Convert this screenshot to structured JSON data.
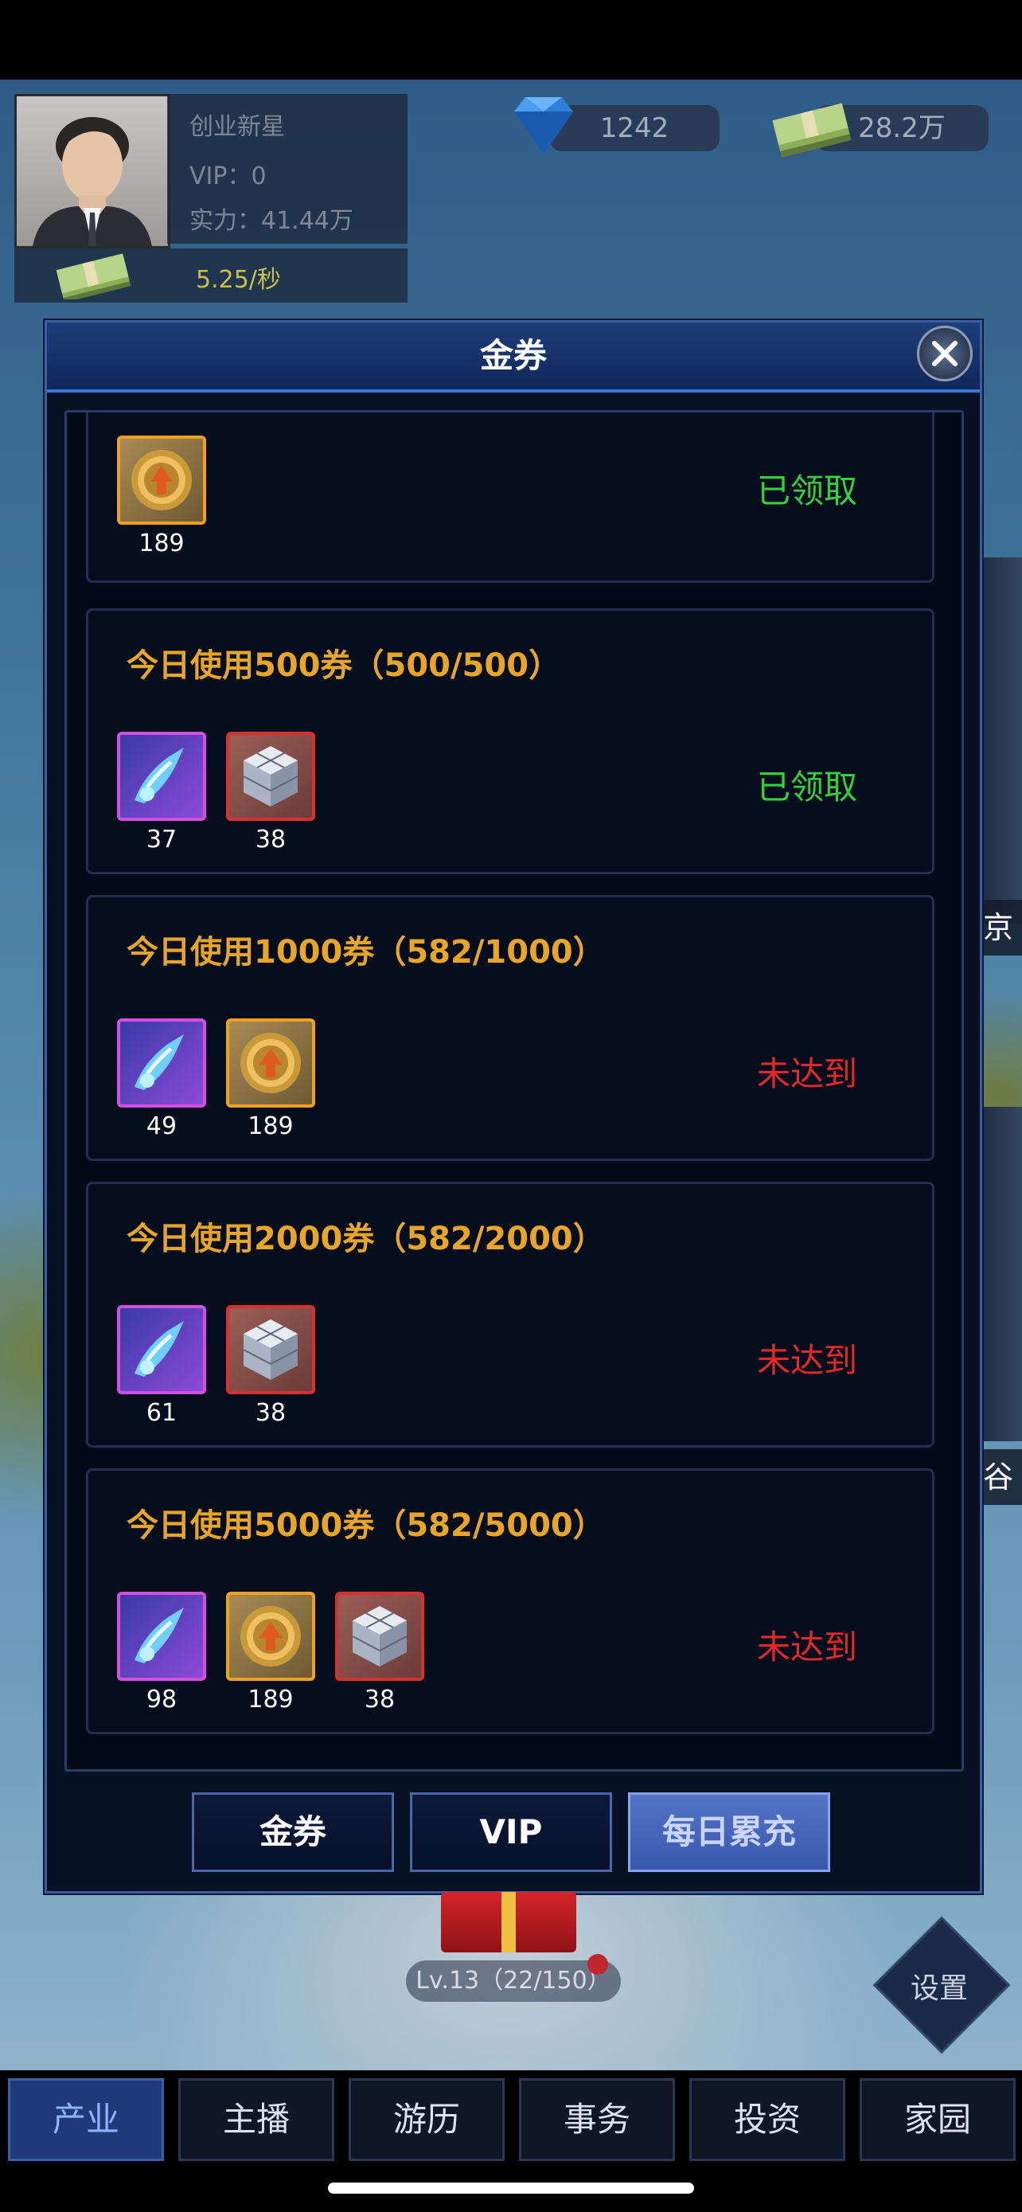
{
  "player": {
    "name": "创业新星",
    "vip": "VIP：0",
    "power": "实力：41.44万",
    "income_rate": "5.25/秒"
  },
  "resources": {
    "diamonds": "1242",
    "cash": "28.2万"
  },
  "map_labels": [
    "京",
    "谷"
  ],
  "dialog": {
    "title": "金券",
    "cards": [
      {
        "title": "",
        "items": [
          {
            "icon": "gold-gear-icon",
            "count": "189"
          }
        ],
        "status": "已领取",
        "status_color": "#32d23c"
      },
      {
        "title": "今日使用500券（500/500）",
        "items": [
          {
            "icon": "blue-crystal-icon",
            "count": "37"
          },
          {
            "icon": "ice-cube-icon",
            "count": "38"
          }
        ],
        "status": "已领取",
        "status_color": "#32d23c"
      },
      {
        "title": "今日使用1000券（582/1000）",
        "items": [
          {
            "icon": "blue-crystal-icon",
            "count": "49"
          },
          {
            "icon": "gold-gear-icon",
            "count": "189"
          }
        ],
        "status": "未达到",
        "status_color": "#e4282a"
      },
      {
        "title": "今日使用2000券（582/2000）",
        "items": [
          {
            "icon": "blue-crystal-icon",
            "count": "61"
          },
          {
            "icon": "ice-cube-icon",
            "count": "38"
          }
        ],
        "status": "未达到",
        "status_color": "#e4282a"
      },
      {
        "title": "今日使用5000券（582/5000）",
        "items": [
          {
            "icon": "blue-crystal-icon",
            "count": "98"
          },
          {
            "icon": "gold-gear-icon",
            "count": "189"
          },
          {
            "icon": "ice-cube-icon",
            "count": "38"
          }
        ],
        "status": "未达到",
        "status_color": "#e4282a"
      }
    ],
    "tabs": [
      {
        "label": "金券",
        "active": false
      },
      {
        "label": "VIP",
        "active": false
      },
      {
        "label": "每日累充",
        "active": true
      }
    ]
  },
  "level": "Lv.13（22/150）",
  "settings_label": "设置",
  "nav": [
    {
      "label": "产业",
      "active": true
    },
    {
      "label": "主播",
      "active": false
    },
    {
      "label": "游历",
      "active": false
    },
    {
      "label": "事务",
      "active": false
    },
    {
      "label": "投资",
      "active": false
    },
    {
      "label": "家园",
      "active": false
    }
  ]
}
